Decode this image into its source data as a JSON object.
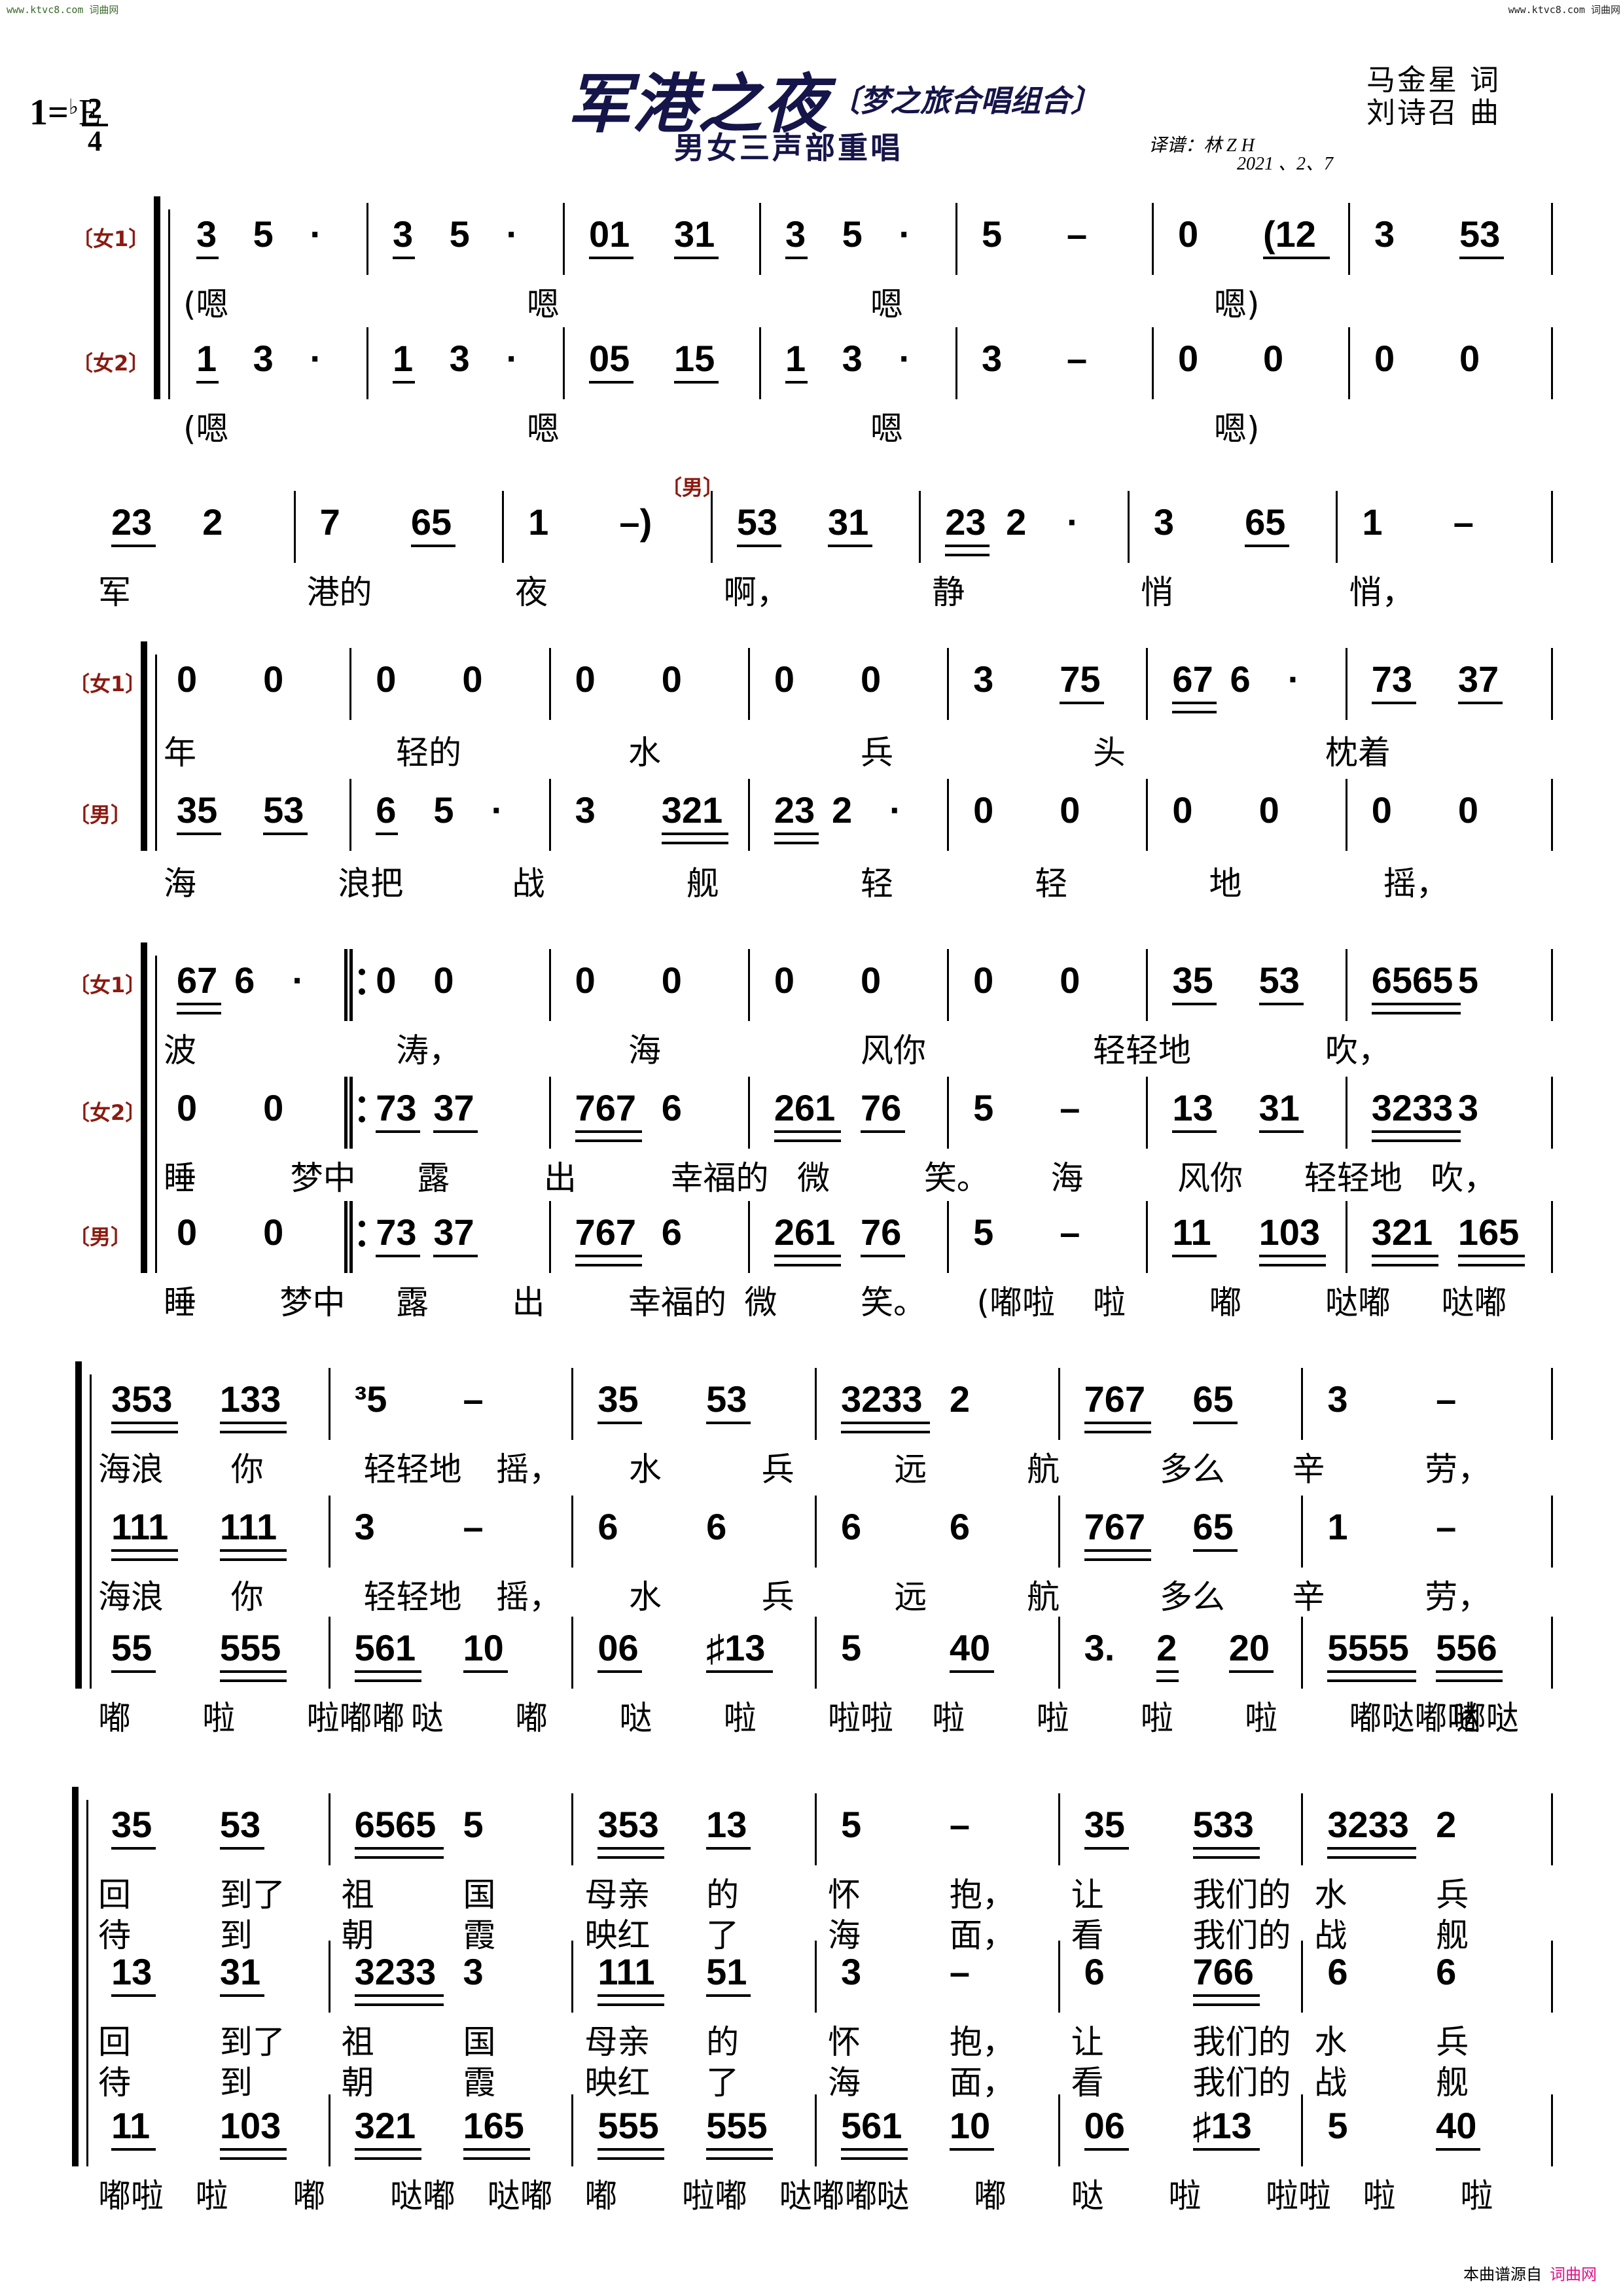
{
  "watermark": {
    "left": "www.ktvc8.com 词曲网",
    "right": "www.ktvc8.com 词曲网"
  },
  "header": {
    "key": {
      "tonic": "1=",
      "flat": "♭",
      "note": "E"
    },
    "time_signature": {
      "top": "2",
      "bottom": "4"
    },
    "title": "军港之夜",
    "performer": "〔梦之旅合唱组合〕",
    "subtitle": "男女三声部重唱",
    "transcriber": "译谱：林 Z H",
    "date": "2021 、2、7",
    "lyricist": "马金星 词",
    "composer": "刘诗召 曲"
  },
  "footer": {
    "text": "本曲谱源自",
    "brand": "词曲网"
  },
  "systems": [
    {
      "id": "system-1",
      "top": 0,
      "brace": true,
      "parts": [
        {
          "label": "〔女1〕",
          "measures": [
            [
              "3_ 5 ·"
            ],
            [
              "3_ 5 ·"
            ],
            [
              "01_ 31_"
            ],
            [
              "3_ 5 ·"
            ],
            [
              "5 –"
            ],
            [
              "0 (12_"
            ],
            [
              "3 53_"
            ]
          ],
          "lyrics": [
            [
              "(嗯",
              "嗯",
              "嗯",
              "嗯)"
            ]
          ]
        },
        {
          "label": "〔女2〕",
          "measures": [
            [
              "1_ 3 ·"
            ],
            [
              "1_ 3 ·"
            ],
            [
              "05_ 15_"
            ],
            [
              "1_ 3 ·"
            ],
            [
              "3 –"
            ],
            [
              "0 0"
            ],
            [
              "0 0"
            ]
          ],
          "lyrics": [
            [
              "(嗯",
              "嗯",
              "嗯",
              "嗯)"
            ]
          ]
        }
      ]
    },
    {
      "id": "system-2",
      "brace": false,
      "annotation": "〔男〕",
      "parts": [
        {
          "label": "",
          "measures": [
            [
              "23_ 2"
            ],
            [
              "7 65_"
            ],
            [
              "1 –)"
            ],
            [
              "53_ 31_"
            ],
            [
              "23= 2 ·"
            ],
            [
              "3 65_"
            ],
            [
              "1 –"
            ]
          ],
          "lyrics": [
            [
              "军",
              "港的",
              "夜",
              "啊，",
              "静",
              "悄",
              "悄，"
            ]
          ]
        }
      ]
    },
    {
      "id": "system-3",
      "brace": true,
      "parts": [
        {
          "label": "〔女1〕",
          "measures": [
            [
              "0 0"
            ],
            [
              "0 0"
            ],
            [
              "0 0"
            ],
            [
              "0 0"
            ],
            [
              "3 75_"
            ],
            [
              "67= 6 ·"
            ],
            [
              "73_ 37_"
            ]
          ],
          "lyrics": [
            [
              "年",
              "轻的",
              "水",
              "兵",
              "头",
              "枕着"
            ]
          ]
        },
        {
          "label": "〔男〕",
          "measures": [
            [
              "35_ 53_"
            ],
            [
              "6_ 5 ·"
            ],
            [
              "3 321="
            ],
            [
              "23= 2 ·"
            ],
            [
              "0 0"
            ],
            [
              "0 0"
            ],
            [
              "0 0"
            ]
          ],
          "lyrics": [
            [
              "海",
              "浪把",
              "战",
              "舰",
              "轻",
              "轻",
              "地",
              "摇，"
            ]
          ]
        }
      ]
    },
    {
      "id": "system-4",
      "brace": true,
      "parts": [
        {
          "label": "〔女1〕",
          "measures": [
            [
              "67= 6 ·"
            ],
            [
              "𝄆 0 0"
            ],
            [
              "0 0"
            ],
            [
              "0 0"
            ],
            [
              "0 0"
            ],
            [
              "35_ 53_"
            ],
            [
              "6565= 5"
            ]
          ],
          "lyrics": [
            [
              "波",
              "涛，",
              "海",
              "风你",
              "轻轻地",
              "吹，"
            ]
          ]
        },
        {
          "label": "〔女2〕",
          "measures": [
            [
              "0 0"
            ],
            [
              "𝄆 73_ 37_"
            ],
            [
              "767= 6"
            ],
            [
              "261= 76_"
            ],
            [
              "5 –"
            ],
            [
              "13_ 31_"
            ],
            [
              "3233= 3"
            ]
          ],
          "lyrics": [
            [
              "睡",
              "梦中",
              "露",
              "出",
              "幸福的",
              "微",
              "笑。",
              "海",
              "风你",
              "轻轻地",
              "吹，"
            ]
          ]
        },
        {
          "label": "〔男〕",
          "measures": [
            [
              "0 0"
            ],
            [
              "𝄆 73_ 37_"
            ],
            [
              "767= 6"
            ],
            [
              "261= 76_"
            ],
            [
              "5 –"
            ],
            [
              "11_ 103="
            ],
            [
              "321= 165="
            ]
          ],
          "lyrics": [
            [
              "睡",
              "梦中",
              "露",
              "出",
              "幸福的",
              "微",
              "笑。",
              "(嘟啦",
              "啦",
              "嘟",
              "哒嘟",
              "哒嘟"
            ]
          ]
        }
      ]
    },
    {
      "id": "system-5",
      "brace": true,
      "parts": [
        {
          "label": "",
          "measures": [
            [
              "353= 133="
            ],
            [
              "³5 –"
            ],
            [
              "35_ 53_"
            ],
            [
              "3233= 2"
            ],
            [
              "767= 65_"
            ],
            [
              "3 –"
            ]
          ],
          "lyrics": [
            [
              "海浪",
              "你",
              "轻轻地",
              "摇，",
              "水",
              "兵",
              "远",
              "航",
              "多么",
              "辛",
              "劳，"
            ]
          ]
        },
        {
          "label": "",
          "measures": [
            [
              "111= 111="
            ],
            [
              "3 –"
            ],
            [
              "6 6"
            ],
            [
              "6 6"
            ],
            [
              "767= 65_"
            ],
            [
              "1 –"
            ]
          ],
          "lyrics": [
            [
              "海浪",
              "你",
              "轻轻地",
              "摇，",
              "水",
              "兵",
              "远",
              "航",
              "多么",
              "辛",
              "劳，"
            ]
          ]
        },
        {
          "label": "",
          "measures": [
            [
              "55_ 555="
            ],
            [
              "561= 10_"
            ],
            [
              "06_ ♯13_"
            ],
            [
              "5 40_"
            ],
            [
              "3. 2= 20_"
            ],
            [
              "5555= 556="
            ]
          ],
          "lyrics": [
            [
              "嘟",
              "啦",
              "啦嘟嘟",
              "哒",
              "嘟",
              "哒",
              "啦",
              "啦啦",
              "啦",
              "啦",
              "啦",
              "啦",
              "嘟哒嘟哒",
              "嘟哒"
            ]
          ]
        }
      ]
    },
    {
      "id": "system-6",
      "brace": true,
      "parts": [
        {
          "label": "",
          "measures": [
            [
              "35_ 53_"
            ],
            [
              "6565= 5"
            ],
            [
              "353= 13_"
            ],
            [
              "5 –"
            ],
            [
              "35_ 533="
            ],
            [
              "3233= 2"
            ]
          ],
          "lyrics": [
            [
              "回",
              "到了",
              "祖",
              "国",
              "母亲",
              "的",
              "怀",
              "抱，",
              "让",
              "我们的",
              "水",
              "兵"
            ],
            [
              "待",
              "到",
              "朝",
              "霞",
              "映红",
              "了",
              "海",
              "面，",
              "看",
              "我们的",
              "战",
              "舰"
            ]
          ]
        },
        {
          "label": "",
          "measures": [
            [
              "13_ 31_"
            ],
            [
              "3233= 3"
            ],
            [
              "111= 51_"
            ],
            [
              "3 –"
            ],
            [
              "6 766="
            ],
            [
              "6 6"
            ]
          ],
          "lyrics": [
            [
              "回",
              "到了",
              "祖",
              "国",
              "母亲",
              "的",
              "怀",
              "抱，",
              "让",
              "我们的",
              "水",
              "兵"
            ],
            [
              "待",
              "到",
              "朝",
              "霞",
              "映红",
              "了",
              "海",
              "面，",
              "看",
              "我们的",
              "战",
              "舰"
            ]
          ]
        },
        {
          "label": "",
          "measures": [
            [
              "11_ 103="
            ],
            [
              "321= 165="
            ],
            [
              "555= 555="
            ],
            [
              "561= 10_"
            ],
            [
              "06_ ♯13_"
            ],
            [
              "5 40_"
            ]
          ],
          "lyrics": [
            [
              "嘟啦",
              "啦",
              "嘟",
              "哒嘟",
              "哒嘟",
              "嘟",
              "啦嘟",
              "哒嘟嘟",
              "哒",
              "嘟",
              "哒",
              "啦",
              "啦啦",
              "啦",
              "啦"
            ]
          ]
        }
      ]
    }
  ]
}
